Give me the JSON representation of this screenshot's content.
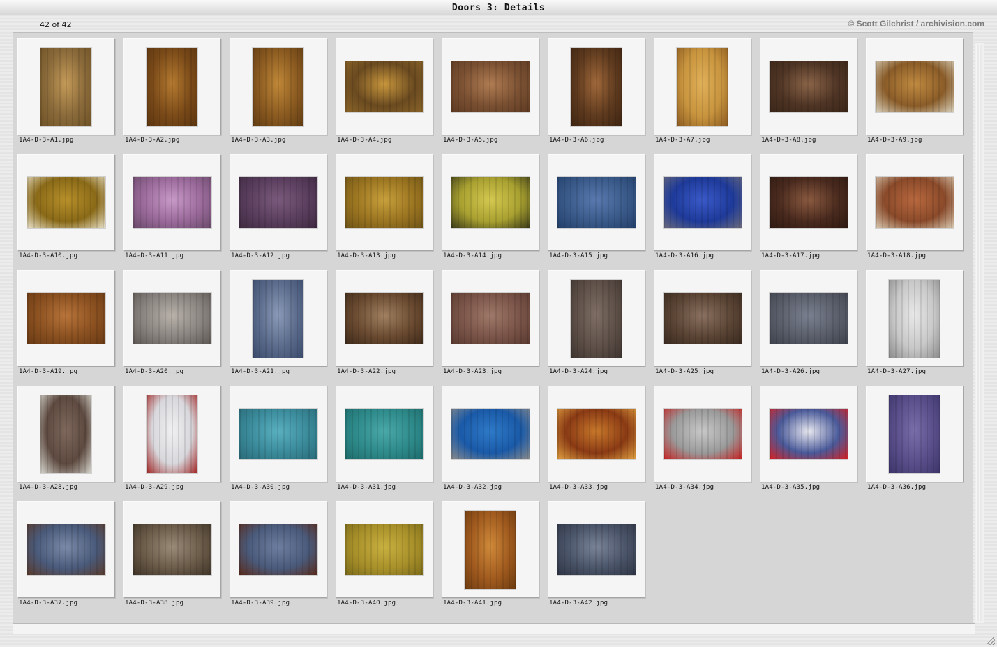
{
  "window": {
    "title": "Doors 3: Details"
  },
  "header": {
    "count": "42 of 42",
    "credit": "© Scott Gilchrist / archivision.com"
  },
  "thumbnails": [
    {
      "file": "1A4-D-3-A1.jpg",
      "orientation": "portrait",
      "colors": [
        "#8a6a3a",
        "#c49a58",
        "#6e5226"
      ]
    },
    {
      "file": "1A4-D-3-A2.jpg",
      "orientation": "portrait",
      "colors": [
        "#7a4a18",
        "#b57a30",
        "#5a3410"
      ]
    },
    {
      "file": "1A4-D-3-A3.jpg",
      "orientation": "portrait",
      "colors": [
        "#8a5a20",
        "#c08838",
        "#5e3a12"
      ]
    },
    {
      "file": "1A4-D-3-A4.jpg",
      "orientation": "landscape",
      "colors": [
        "#6a4a20",
        "#c8963c",
        "#8a6428"
      ]
    },
    {
      "file": "1A4-D-3-A5.jpg",
      "orientation": "landscape",
      "colors": [
        "#7a5032",
        "#b07c52",
        "#5e3a22"
      ]
    },
    {
      "file": "1A4-D-3-A6.jpg",
      "orientation": "portrait",
      "colors": [
        "#5e3a1e",
        "#a0683a",
        "#3e2412"
      ]
    },
    {
      "file": "1A4-D-3-A7.jpg",
      "orientation": "portrait",
      "colors": [
        "#c8943e",
        "#e0b058",
        "#8a5a20"
      ]
    },
    {
      "file": "1A4-D-3-A8.jpg",
      "orientation": "landscape",
      "colors": [
        "#4e3424",
        "#8a6448",
        "#3a2618"
      ]
    },
    {
      "file": "1A4-D-3-A9.jpg",
      "orientation": "landscape",
      "colors": [
        "#8a5c28",
        "#c08a40",
        "#d8d0bc"
      ]
    },
    {
      "file": "1A4-D-3-A10.jpg",
      "orientation": "landscape",
      "colors": [
        "#8a6a18",
        "#b8902a",
        "#e8e0c8"
      ]
    },
    {
      "file": "1A4-D-3-A11.jpg",
      "orientation": "landscape",
      "colors": [
        "#9a6a9a",
        "#c89ac8",
        "#6a4a6a"
      ]
    },
    {
      "file": "1A4-D-3-A12.jpg",
      "orientation": "landscape",
      "colors": [
        "#5a3e5e",
        "#7a5a7c",
        "#3e2a40"
      ]
    },
    {
      "file": "1A4-D-3-A13.jpg",
      "orientation": "landscape",
      "colors": [
        "#9a7420",
        "#c8a03c",
        "#6e5418"
      ]
    },
    {
      "file": "1A4-D-3-A14.jpg",
      "orientation": "landscape",
      "colors": [
        "#a8a030",
        "#d4c850",
        "#3a3a18"
      ]
    },
    {
      "file": "1A4-D-3-A15.jpg",
      "orientation": "landscape",
      "colors": [
        "#3a5a8a",
        "#5a7ab0",
        "#24406a"
      ]
    },
    {
      "file": "1A4-D-3-A16.jpg",
      "orientation": "landscape",
      "colors": [
        "#1e3a9a",
        "#3a5ac8",
        "#6a6a7a"
      ]
    },
    {
      "file": "1A4-D-3-A17.jpg",
      "orientation": "landscape",
      "colors": [
        "#4a2a1e",
        "#8a5a40",
        "#2e1a12"
      ]
    },
    {
      "file": "1A4-D-3-A18.jpg",
      "orientation": "landscape",
      "colors": [
        "#8a4a2a",
        "#b8683e",
        "#d8c8b0"
      ]
    },
    {
      "file": "1A4-D-3-A19.jpg",
      "orientation": "landscape",
      "colors": [
        "#8a5020",
        "#b8743a",
        "#6a3a14"
      ]
    },
    {
      "file": "1A4-D-3-A20.jpg",
      "orientation": "landscape",
      "colors": [
        "#8a8480",
        "#b8b2aa",
        "#5e5854"
      ]
    },
    {
      "file": "1A4-D-3-A21.jpg",
      "orientation": "portrait",
      "colors": [
        "#5a6a8a",
        "#8a9ab8",
        "#3a4a6a"
      ]
    },
    {
      "file": "1A4-D-3-A22.jpg",
      "orientation": "landscape",
      "colors": [
        "#6a4a30",
        "#a08060",
        "#3e2a1a"
      ]
    },
    {
      "file": "1A4-D-3-A23.jpg",
      "orientation": "landscape",
      "colors": [
        "#7a5448",
        "#9e7868",
        "#5a3a30"
      ]
    },
    {
      "file": "1A4-D-3-A24.jpg",
      "orientation": "portrait",
      "colors": [
        "#5e5048",
        "#7e6e64",
        "#3e3430"
      ]
    },
    {
      "file": "1A4-D-3-A25.jpg",
      "orientation": "landscape",
      "colors": [
        "#5a4434",
        "#8a7060",
        "#3a2a20"
      ]
    },
    {
      "file": "1A4-D-3-A26.jpg",
      "orientation": "landscape",
      "colors": [
        "#5a5e6a",
        "#7a8090",
        "#3e424c"
      ]
    },
    {
      "file": "1A4-D-3-A27.jpg",
      "orientation": "portrait",
      "colors": [
        "#c8c8c8",
        "#e8e8e8",
        "#8a8a8a"
      ]
    },
    {
      "file": "1A4-D-3-A28.jpg",
      "orientation": "portrait",
      "colors": [
        "#5e4a40",
        "#7e685c",
        "#d8d8d0"
      ]
    },
    {
      "file": "1A4-D-3-A29.jpg",
      "orientation": "portrait",
      "colors": [
        "#d8d8dc",
        "#f0f0f2",
        "#a02020"
      ]
    },
    {
      "file": "1A4-D-3-A30.jpg",
      "orientation": "landscape",
      "colors": [
        "#3a8a9a",
        "#5ab0c0",
        "#2a6a78"
      ]
    },
    {
      "file": "1A4-D-3-A31.jpg",
      "orientation": "landscape",
      "colors": [
        "#2e8a8a",
        "#4aa8a8",
        "#1e6a6a"
      ]
    },
    {
      "file": "1A4-D-3-A32.jpg",
      "orientation": "landscape",
      "colors": [
        "#1a5aa8",
        "#2e7ac8",
        "#8a8a8a"
      ]
    },
    {
      "file": "1A4-D-3-A33.jpg",
      "orientation": "landscape",
      "colors": [
        "#8a3a14",
        "#c8782a",
        "#e0a040"
      ]
    },
    {
      "file": "1A4-D-3-A34.jpg",
      "orientation": "landscape",
      "colors": [
        "#9a9a9a",
        "#c8c8c8",
        "#c82020"
      ]
    },
    {
      "file": "1A4-D-3-A35.jpg",
      "orientation": "landscape",
      "colors": [
        "#4a5a9a",
        "#e8e8f0",
        "#d82020"
      ]
    },
    {
      "file": "1A4-D-3-A36.jpg",
      "orientation": "portrait",
      "colors": [
        "#5a4e8a",
        "#7a6eaa",
        "#3a3468"
      ]
    },
    {
      "file": "1A4-D-3-A37.jpg",
      "orientation": "landscape",
      "colors": [
        "#4a5a7a",
        "#7a8aa8",
        "#5a3a2a"
      ]
    },
    {
      "file": "1A4-D-3-A38.jpg",
      "orientation": "landscape",
      "colors": [
        "#6a5a48",
        "#9a8a78",
        "#3e3428"
      ]
    },
    {
      "file": "1A4-D-3-A39.jpg",
      "orientation": "landscape",
      "colors": [
        "#4a5a7a",
        "#6e7ea0",
        "#5a2a1a"
      ]
    },
    {
      "file": "1A4-D-3-A40.jpg",
      "orientation": "landscape",
      "colors": [
        "#a8902a",
        "#c8b040",
        "#7a6a1a"
      ]
    },
    {
      "file": "1A4-D-3-A41.jpg",
      "orientation": "portrait",
      "colors": [
        "#a05a1e",
        "#d08a3a",
        "#6a3a10"
      ]
    },
    {
      "file": "1A4-D-3-A42.jpg",
      "orientation": "landscape",
      "colors": [
        "#4a5468",
        "#7a8498",
        "#2e3444"
      ]
    }
  ]
}
